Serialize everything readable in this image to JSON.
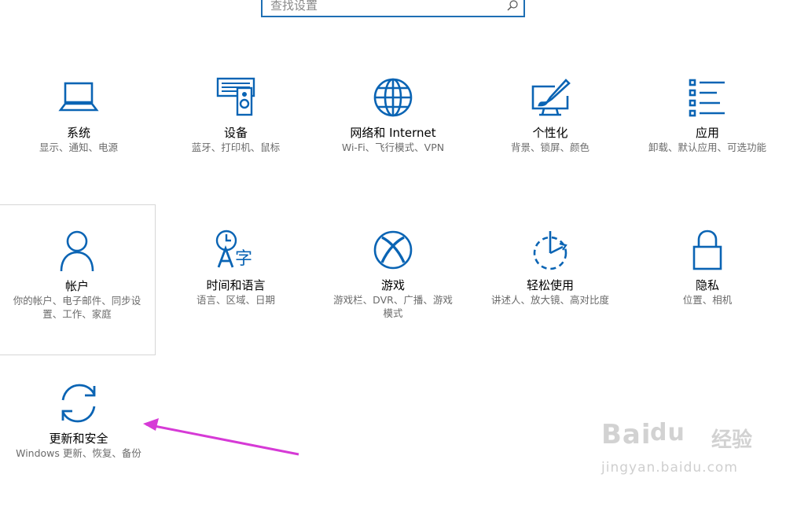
{
  "search": {
    "placeholder": "查找设置"
  },
  "tiles": [
    {
      "title": "系统",
      "desc": "显示、通知、电源",
      "icon": "laptop-icon"
    },
    {
      "title": "设备",
      "desc": "蓝牙、打印机、鼠标",
      "icon": "devices-icon"
    },
    {
      "title": "网络和 Internet",
      "desc": "Wi-Fi、飞行模式、VPN",
      "icon": "globe-icon"
    },
    {
      "title": "个性化",
      "desc": "背景、锁屏、颜色",
      "icon": "paintbrush-icon"
    },
    {
      "title": "应用",
      "desc": "卸载、默认应用、可选功能",
      "icon": "apps-list-icon"
    },
    {
      "title": "帐户",
      "desc": "你的帐户、电子邮件、同步设置、工作、家庭",
      "icon": "person-icon"
    },
    {
      "title": "时间和语言",
      "desc": "语言、区域、日期",
      "icon": "time-language-icon"
    },
    {
      "title": "游戏",
      "desc": "游戏栏、DVR、广播、游戏模式",
      "icon": "xbox-icon"
    },
    {
      "title": "轻松使用",
      "desc": "讲述人、放大镜、高对比度",
      "icon": "ease-of-access-icon"
    },
    {
      "title": "隐私",
      "desc": "位置、相机",
      "icon": "lock-icon"
    },
    {
      "title": "更新和安全",
      "desc": "Windows 更新、恢复、备份",
      "icon": "sync-icon"
    }
  ],
  "watermark": {
    "brand": "Bai",
    "brand_mid": "du",
    "brand_cn": "经验",
    "url": "jingyan.baidu.com"
  },
  "colors": {
    "accent": "#0a64b4",
    "arrow": "#d63ad6",
    "border": "#d6d6d6"
  }
}
